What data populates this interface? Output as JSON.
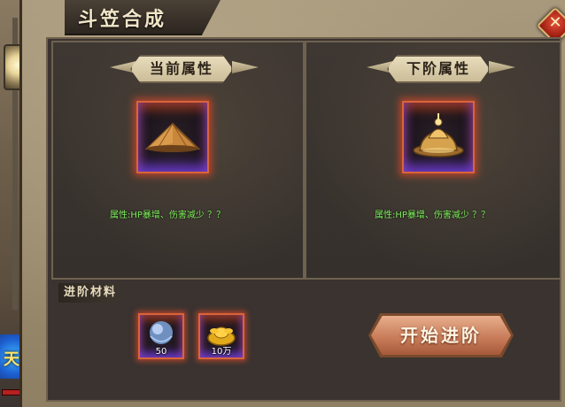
{
  "window": {
    "title": "斗笠合成"
  },
  "current": {
    "header": "当前属性",
    "attr_text": "属性:HP暴增、伤害减少 ？？"
  },
  "next": {
    "header": "下阶属性",
    "attr_text": "属性:HP暴增、伤害减少 ？？"
  },
  "materials": {
    "label": "进阶材料",
    "items": [
      {
        "icon": "crystal-orb-icon",
        "count": "50"
      },
      {
        "icon": "gold-ingot-icon",
        "count": "10万"
      }
    ]
  },
  "actions": {
    "start_label": "开始进阶"
  },
  "world": {
    "badge_text": "天改"
  },
  "colors": {
    "attr_green": "#7ef15c",
    "slot_glow": "#d9643a",
    "button": "#c97d5a"
  }
}
